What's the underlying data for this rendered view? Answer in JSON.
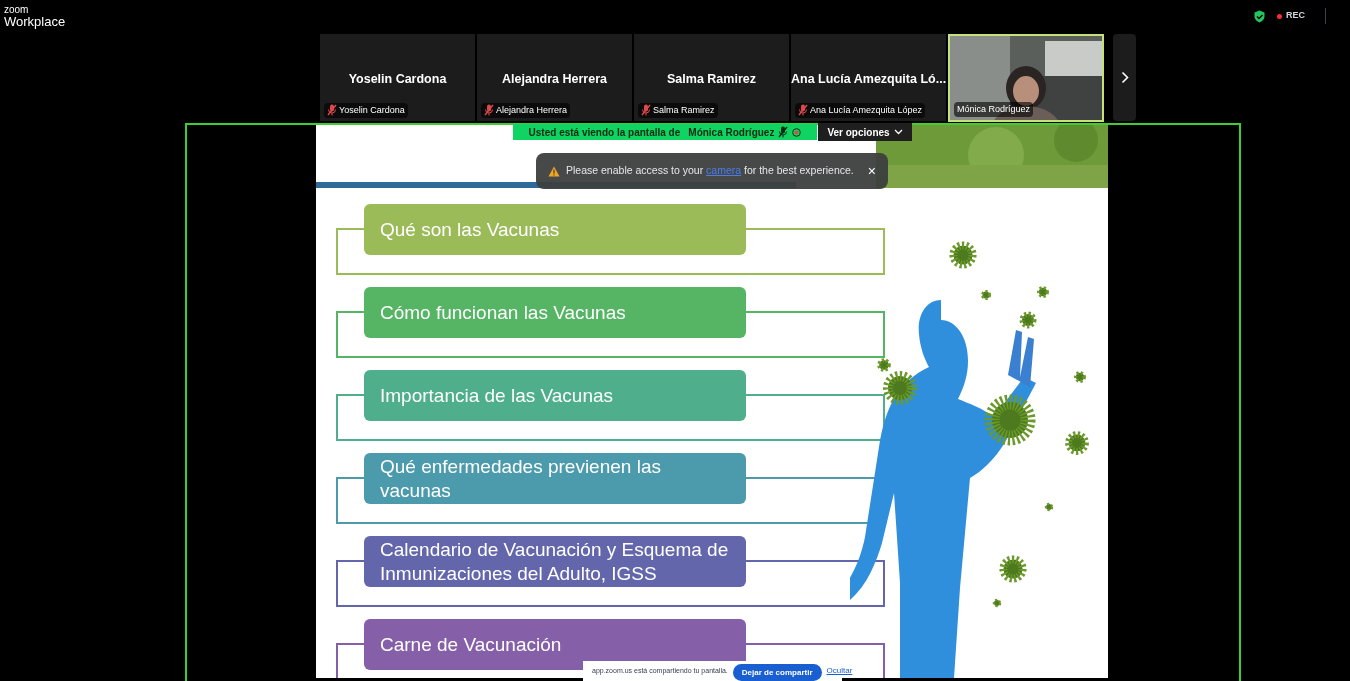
{
  "app": {
    "brand_small": "zoom",
    "brand": "Workplace",
    "rec": "REC"
  },
  "participants": [
    {
      "name": "Yoselin Cardona",
      "label": "Yoselin Cardona",
      "muted": true,
      "kind": "avatar"
    },
    {
      "name": "Alejandra Herrera",
      "label": "Alejandra Herrera",
      "muted": true,
      "kind": "avatar"
    },
    {
      "name": "Salma Ramirez",
      "label": "Salma Ramirez",
      "muted": true,
      "kind": "avatar"
    },
    {
      "name": "Ana Lucía Amezquita Ló...",
      "label": "Ana Lucía Amezquita López",
      "muted": true,
      "kind": "avatar"
    },
    {
      "label": "Mónica Rodríguez",
      "muted": false,
      "kind": "video"
    }
  ],
  "share_banner": {
    "text": "Usted está viendo la pantalla de",
    "presenter": "Mónica Rodríguez",
    "options": "Ver opciones"
  },
  "toast": {
    "before": "Please enable access to your",
    "link": "camera",
    "after": "for the best experience.",
    "close": "×"
  },
  "slide": {
    "items": [
      {
        "text": "Qué son las Vacunas",
        "color": "#9bbb59"
      },
      {
        "text": "Cómo funcionan las Vacunas",
        "color": "#55b565"
      },
      {
        "text": "Importancia de las Vacunas",
        "color": "#4fae8c"
      },
      {
        "text": "Qué enfermedades previenen las vacunas",
        "color": "#4b9bad"
      },
      {
        "text": "Calendario de Vacunación y Esquema de Inmunizaciones del Adulto, IGSS",
        "color": "#6466ab"
      },
      {
        "text": "Carne de Vacunación",
        "color": "#8560a8"
      }
    ]
  },
  "share_bar": {
    "text": "app.zoom.us está compartiendo tu pantalla.",
    "button": "Dejar de compartir",
    "link": "Ocultar"
  }
}
